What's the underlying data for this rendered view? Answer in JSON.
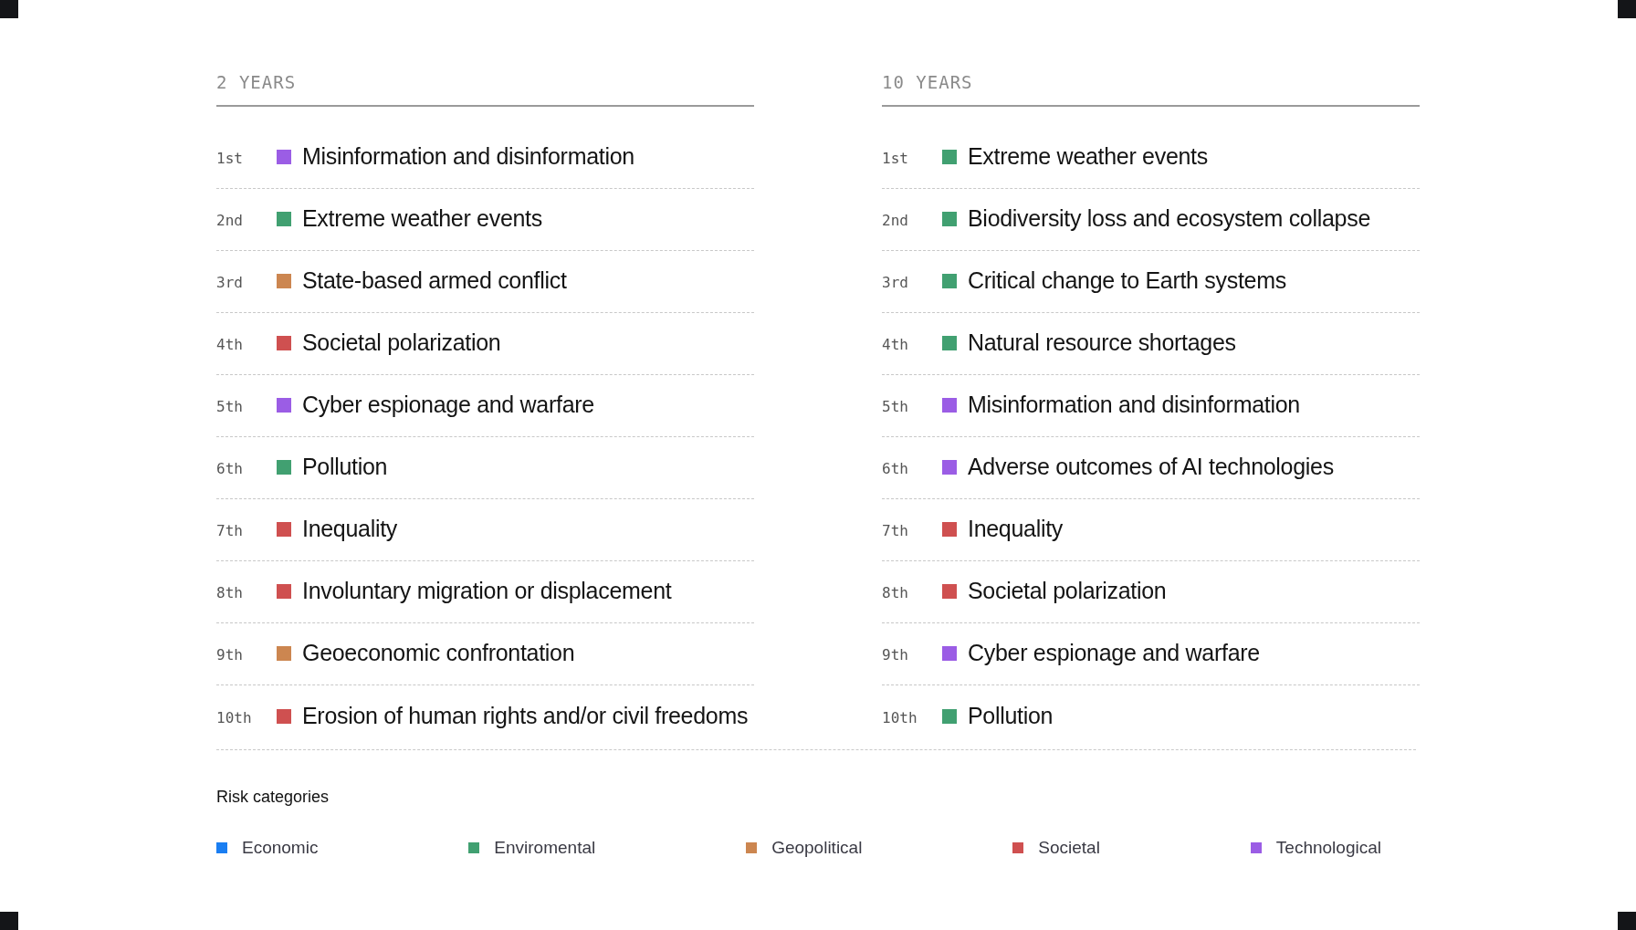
{
  "columns": [
    {
      "heading": "2 YEARS",
      "items": [
        {
          "rank": "1st",
          "label": "Misinformation and disinformation",
          "color": "#9b5de5"
        },
        {
          "rank": "2nd",
          "label": "Extreme weather events",
          "color": "#41a071"
        },
        {
          "rank": "3rd",
          "label": "State-based armed conflict",
          "color": "#cc8650"
        },
        {
          "rank": "4th",
          "label": "Societal polarization",
          "color": "#cf5050"
        },
        {
          "rank": "5th",
          "label": "Cyber espionage and warfare",
          "color": "#9b5de5"
        },
        {
          "rank": "6th",
          "label": "Pollution",
          "color": "#41a071"
        },
        {
          "rank": "7th",
          "label": "Inequality",
          "color": "#cf5050"
        },
        {
          "rank": "8th",
          "label": "Involuntary migration or displacement",
          "color": "#cf5050"
        },
        {
          "rank": "9th",
          "label": "Geoeconomic confrontation",
          "color": "#cc8650"
        },
        {
          "rank": "10th",
          "label": "Erosion of human rights and/or civil freedoms",
          "color": "#cf5050"
        }
      ]
    },
    {
      "heading": "10 YEARS",
      "items": [
        {
          "rank": "1st",
          "label": "Extreme weather events",
          "color": "#41a071"
        },
        {
          "rank": "2nd",
          "label": "Biodiversity loss and ecosystem collapse",
          "color": "#41a071"
        },
        {
          "rank": "3rd",
          "label": "Critical change to Earth systems",
          "color": "#41a071"
        },
        {
          "rank": "4th",
          "label": "Natural resource shortages",
          "color": "#41a071"
        },
        {
          "rank": "5th",
          "label": "Misinformation and disinformation",
          "color": "#9b5de5"
        },
        {
          "rank": "6th",
          "label": "Adverse outcomes of AI technologies",
          "color": "#9b5de5"
        },
        {
          "rank": "7th",
          "label": "Inequality",
          "color": "#cf5050"
        },
        {
          "rank": "8th",
          "label": "Societal polarization",
          "color": "#cf5050"
        },
        {
          "rank": "9th",
          "label": "Cyber espionage and warfare",
          "color": "#9b5de5"
        },
        {
          "rank": "10th",
          "label": "Pollution",
          "color": "#41a071"
        }
      ]
    }
  ],
  "legend": {
    "title": "Risk categories",
    "items": [
      {
        "label": "Economic",
        "color": "#1a7ef2"
      },
      {
        "label": "Enviromental",
        "color": "#41a071"
      },
      {
        "label": "Geopolitical",
        "color": "#cc8650"
      },
      {
        "label": "Societal",
        "color": "#cf5050"
      },
      {
        "label": "Technological",
        "color": "#9b5de5"
      }
    ]
  }
}
